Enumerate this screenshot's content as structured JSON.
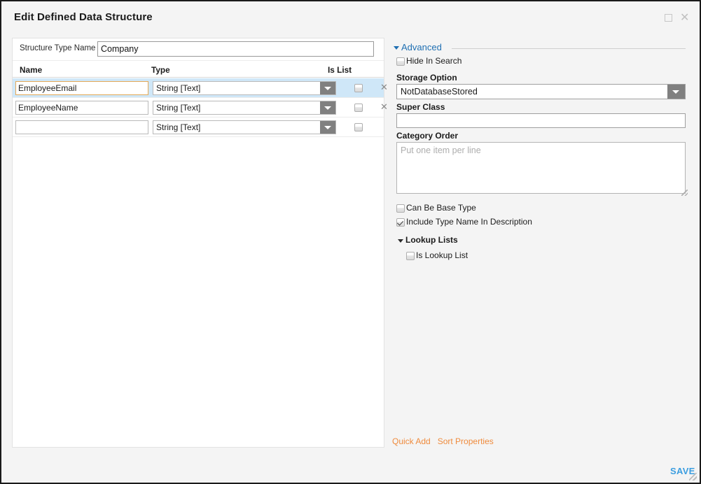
{
  "window": {
    "title": "Edit Defined Data Structure",
    "maximize_icon": "maximize-icon",
    "close_icon": "close-icon"
  },
  "left_panel": {
    "structure_type_name_label": "Structure Type Name",
    "structure_type_name_value": "Company",
    "columns": {
      "name": "Name",
      "type": "Type",
      "is_list": "Is List"
    },
    "rows": [
      {
        "name": "EmployeeEmail",
        "type": "String [Text]",
        "is_list": false,
        "selected": true,
        "removable": true
      },
      {
        "name": "EmployeeName",
        "type": "String [Text]",
        "is_list": false,
        "selected": false,
        "removable": true
      },
      {
        "name": "",
        "type": "String [Text]",
        "is_list": false,
        "selected": false,
        "removable": false
      }
    ],
    "remove_icon": "close-icon"
  },
  "right_panel": {
    "advanced_label": "Advanced",
    "hide_in_search_label": "Hide In Search",
    "hide_in_search_checked": false,
    "storage_option_label": "Storage Option",
    "storage_option_value": "NotDatabaseStored",
    "super_class_label": "Super Class",
    "super_class_value": "",
    "category_order_label": "Category Order",
    "category_order_value": "",
    "category_order_placeholder": "Put one item per line",
    "can_be_base_type_label": "Can Be Base Type",
    "can_be_base_type_checked": false,
    "include_type_name_label": "Include Type Name In Description",
    "include_type_name_checked": true,
    "lookup_lists_label": "Lookup Lists",
    "is_lookup_list_label": "Is Lookup List",
    "is_lookup_list_checked": false
  },
  "footer": {
    "quick_add_label": "Quick Add",
    "sort_properties_label": "Sort Properties",
    "save_label": "SAVE"
  },
  "colors": {
    "accent_link": "#ef8b3d",
    "save_blue": "#3c9ee0",
    "advanced_blue": "#1f6fb2",
    "row_selected": "#cfe7f8",
    "focus_border": "#e3a857"
  }
}
